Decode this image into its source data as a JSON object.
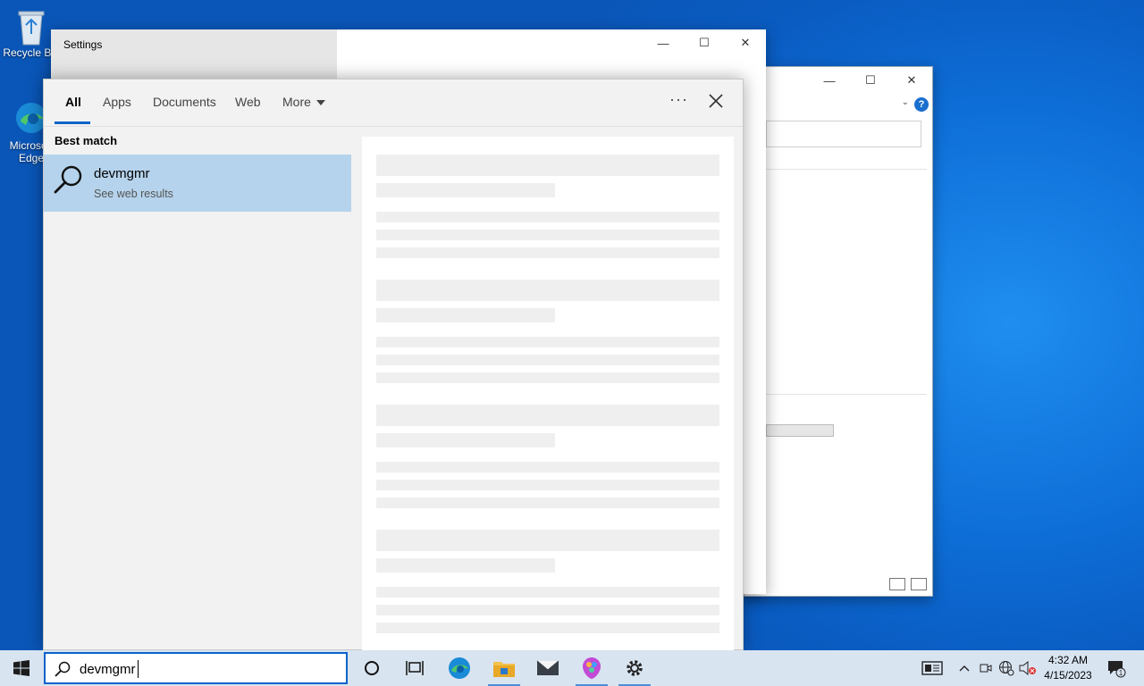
{
  "desktop": {
    "recycle_bin": "Recycle Bin",
    "edge": "Microsoft Edge"
  },
  "settings_window": {
    "title": "Settings",
    "minimize_glyph": "—",
    "maximize_glyph": "☐",
    "close_glyph": "✕"
  },
  "explorer_window": {
    "minimize_glyph": "—",
    "maximize_glyph": "☐",
    "close_glyph": "✕",
    "help_glyph": "?"
  },
  "search": {
    "tabs": [
      "All",
      "Apps",
      "Documents",
      "Web",
      "More"
    ],
    "options_glyph": "···",
    "best_match_label": "Best match",
    "result_title": "devmgmr",
    "result_subtitle": "See web results",
    "query": "devmgmr"
  },
  "taskbar": {
    "icons": [
      "start-icon",
      "cortana-icon",
      "task-view-icon",
      "edge-icon",
      "file-explorer-icon",
      "mail-icon",
      "paint-icon",
      "settings-icon"
    ],
    "time": "4:32 AM",
    "date": "4/15/2023",
    "notification_count": "1"
  },
  "colors": {
    "accent": "#0a63c9",
    "selection": "#b5d3ec",
    "taskbar": "#d9e4f1"
  }
}
